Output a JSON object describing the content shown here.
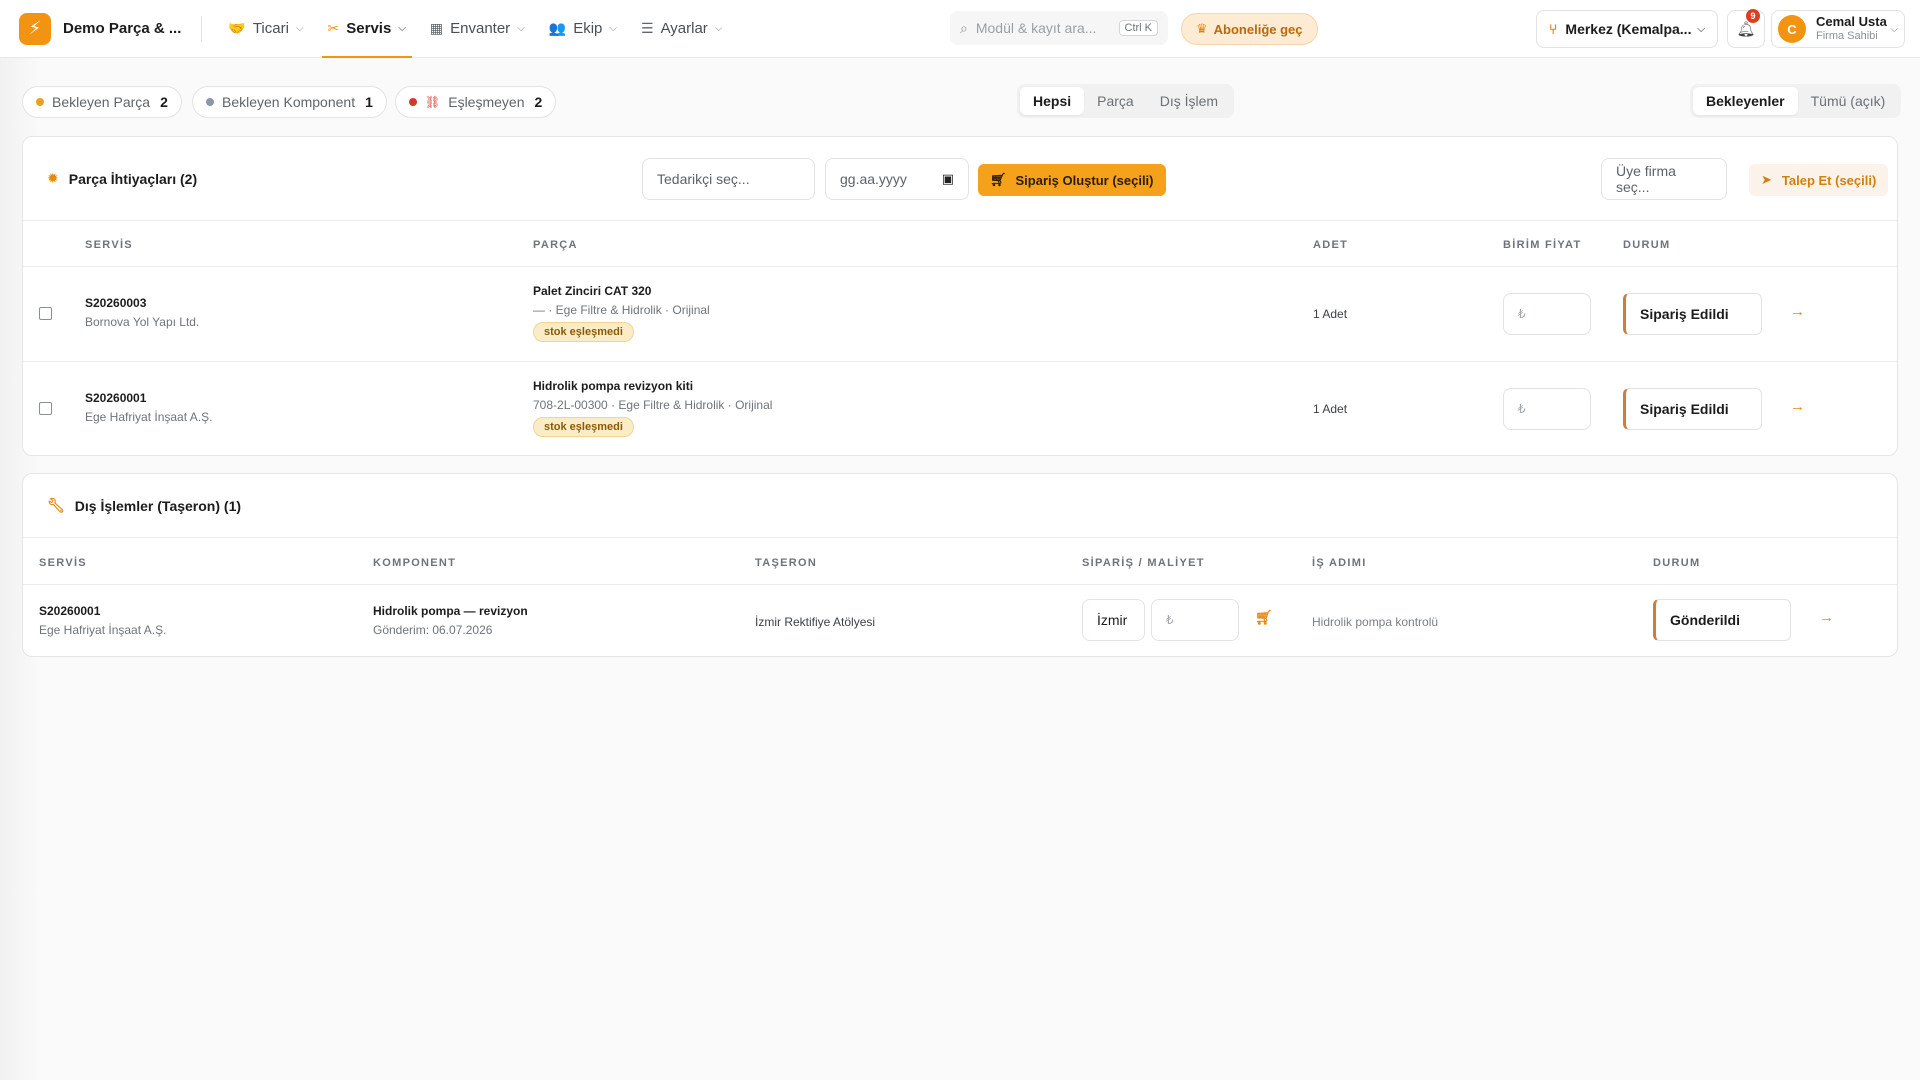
{
  "brand": {
    "name": "Demo Parça & ..."
  },
  "nav": [
    {
      "label": "Ticari"
    },
    {
      "label": "Servis"
    },
    {
      "label": "Envanter"
    },
    {
      "label": "Ekip"
    },
    {
      "label": "Ayarlar"
    }
  ],
  "search": {
    "placeholder": "Modül & kayıt ara...",
    "shortcut": "Ctrl K"
  },
  "subscribe_label": "Aboneliğe geç",
  "branch_label": "Merkez (Kemalpa...",
  "notifications": {
    "count": "9"
  },
  "user": {
    "initial": "C",
    "name": "Cemal Usta",
    "role": "Firma Sahibi"
  },
  "filters": {
    "pills": [
      {
        "label": "Bekleyen Parça",
        "count": "2",
        "color": "#e8a21f"
      },
      {
        "label": "Bekleyen Komponent",
        "count": "1",
        "color": "#8c96a8"
      },
      {
        "label": "Eşleşmeyen",
        "count": "2",
        "color": "#d3382c"
      }
    ],
    "type_tabs": [
      "Hepsi",
      "Parça",
      "Dış İşlem"
    ],
    "type_selected": "Hepsi",
    "scope_tabs": [
      "Bekleyenler",
      "Tümü (açık)"
    ],
    "scope_selected": "Bekleyenler"
  },
  "parts": {
    "title": "Parça İhtiyaçları (2)",
    "supplier_placeholder": "Tedarikçi seç...",
    "date_placeholder": "gg.aa.yyyy",
    "order_button": "Sipariş Oluştur (seçili)",
    "member_placeholder": "Üye firma seç...",
    "request_button": "Talep Et (seçili)",
    "columns": [
      "SERVİS",
      "PARÇA",
      "ADET",
      "BİRİM FİYAT",
      "DURUM"
    ],
    "rows": [
      {
        "service_code": "S20260003",
        "customer": "Bornova Yol Yapı Ltd.",
        "part_name": "Palet Zinciri CAT 320",
        "part_detail": "— · Ege Filtre & Hidrolik · Orijinal",
        "tag": "stok eşleşmedi",
        "qty": "1 Adet",
        "price_placeholder": "₺",
        "status": "Sipariş Edildi"
      },
      {
        "service_code": "S20260001",
        "customer": "Ege Hafriyat İnşaat A.Ş.",
        "part_name": "Hidrolik pompa revizyon kiti",
        "part_detail": "708-2L-00300 · Ege Filtre & Hidrolik · Orijinal",
        "tag": "stok eşleşmedi",
        "qty": "1 Adet",
        "price_placeholder": "₺",
        "status": "Sipariş Edildi"
      }
    ]
  },
  "external": {
    "title": "Dış İşlemler (Taşeron) (1)",
    "columns": [
      "SERVİS",
      "KOMPONENT",
      "TAŞERON",
      "SİPARİŞ / MALİYET",
      "İŞ ADIMI",
      "DURUM"
    ],
    "rows": [
      {
        "service_code": "S20260001",
        "customer": "Ege Hafriyat İnşaat A.Ş.",
        "component": "Hidrolik pompa — revizyon",
        "sent": "Gönderim: 06.07.2026",
        "subcontractor": "İzmir Rektifiye Atölyesi",
        "order_ref": "İzmir",
        "cost_placeholder": "₺",
        "step": "Hidrolik pompa kontrolü",
        "status": "Gönderildi"
      }
    ]
  },
  "colors": {
    "accent": "#f29411",
    "status_bar": "#d07d3b",
    "danger": "#d3382c"
  }
}
